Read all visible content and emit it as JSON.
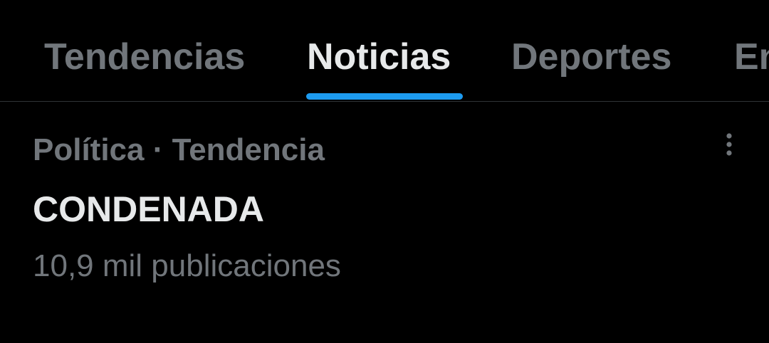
{
  "tabs": [
    {
      "label": "Tendencias",
      "active": false
    },
    {
      "label": "Noticias",
      "active": true
    },
    {
      "label": "Deportes",
      "active": false
    },
    {
      "label": "Entretenimiento",
      "active": false
    }
  ],
  "colors": {
    "background": "#000000",
    "accent": "#1d9bf0",
    "primary_text": "#e7e9ea",
    "secondary_text": "#71767b",
    "divider": "#2f3336"
  },
  "trend": {
    "meta": "Política · Tendencia",
    "title": "CONDENADA",
    "count": "10,9 mil publicaciones",
    "more_icon": "more-vertical-icon"
  }
}
